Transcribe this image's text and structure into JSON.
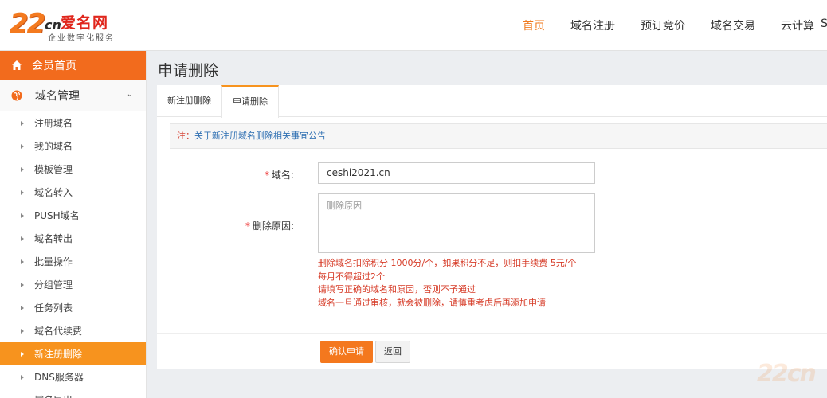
{
  "logo": {
    "mark": "22",
    "cn": "cn",
    "name": "爱名网",
    "slogan": "企业数字化服务"
  },
  "nav": {
    "items": [
      "首页",
      "域名注册",
      "预订竞价",
      "域名交易",
      "云计算"
    ],
    "active_index": 0,
    "overflow_char": "S"
  },
  "sidebar": {
    "home_label": "会员首页",
    "group_label": "域名管理",
    "items": [
      "注册域名",
      "我的域名",
      "模板管理",
      "域名转入",
      "PUSH域名",
      "域名转出",
      "批量操作",
      "分组管理",
      "任务列表",
      "域名代续费",
      "新注册删除",
      "DNS服务器",
      "域名导出"
    ],
    "active_index": 10
  },
  "main": {
    "title": "申请删除",
    "tabs": [
      "新注册删除",
      "申请删除"
    ],
    "active_tab": 1,
    "notice_prefix": "注：",
    "notice_link": "关于新注册域名删除相关事宜公告",
    "form": {
      "domain_label": "域名:",
      "domain_value": "ceshi2021.cn",
      "reason_label": "删除原因:",
      "reason_placeholder": "删除原因",
      "required_mark": "*",
      "hints": [
        "删除域名扣除积分 1000分/个，如果积分不足，则扣手续费 5元/个",
        "每月不得超过2个",
        "请填写正确的域名和原因，否则不予通过",
        "域名一旦通过审核，就会被删除，请慎重考虑后再添加申请"
      ],
      "confirm_button": "确认申请",
      "back_button": "返回"
    },
    "watermark": "22cn"
  },
  "colors": {
    "accent": "#f26b1d",
    "active_item": "#f7931e",
    "hint": "#d63a26",
    "link": "#2e6fb2"
  }
}
